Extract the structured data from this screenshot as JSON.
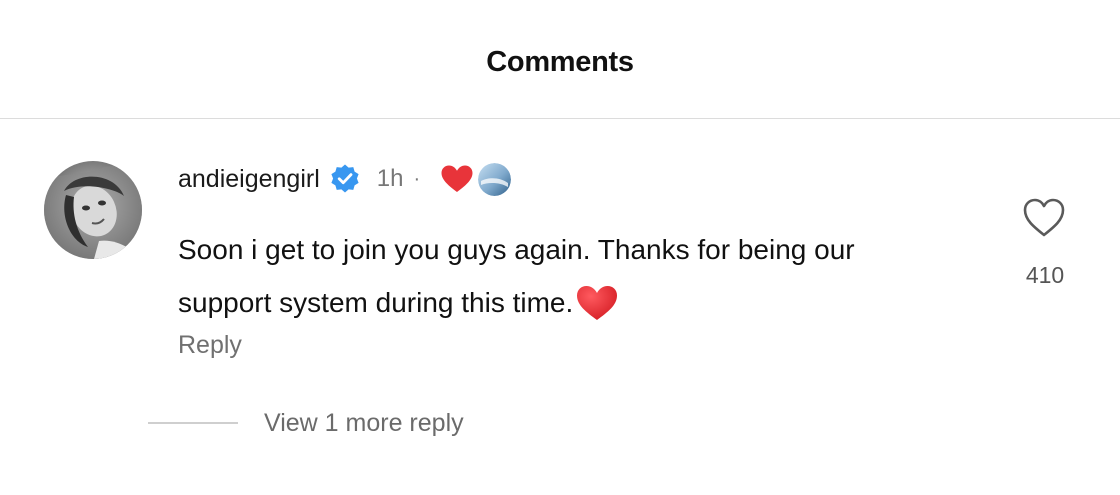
{
  "header": {
    "title": "Comments"
  },
  "comment": {
    "avatar_icon": "profile-photo",
    "username": "andieigengirl",
    "verified_icon": "verified-badge-icon",
    "time": "1h",
    "separator": "·",
    "creator_liked_icon": "red-heart-icon",
    "creator_avatar_icon": "creator-avatar",
    "text": "Soon i get to join you guys again. Thanks for being our support system during this time.",
    "text_emoji": "red-heart-emoji",
    "reply_label": "Reply",
    "like_icon": "heart-outline-icon",
    "like_count": "410",
    "view_more_label": "View 1 more reply"
  },
  "colors": {
    "verified_blue": "#3897f0",
    "heart_red": "#e8343a",
    "secondary_text": "#707070",
    "divider": "#dcdcdc"
  }
}
